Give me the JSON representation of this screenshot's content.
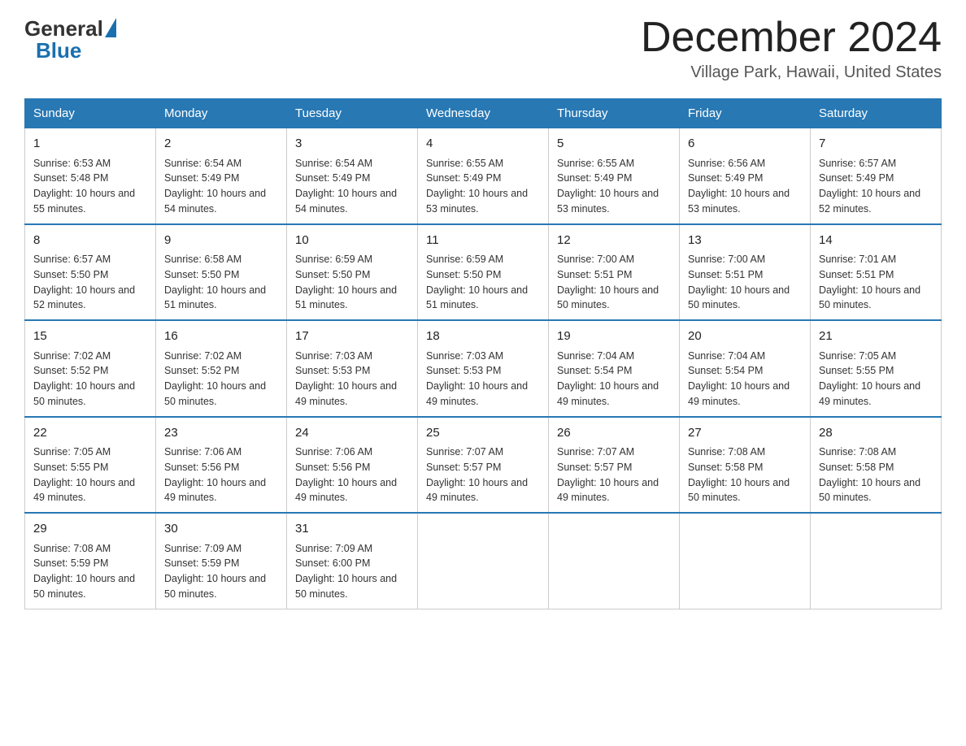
{
  "logo": {
    "general": "General",
    "blue": "Blue",
    "tagline": "Blue"
  },
  "header": {
    "month_year": "December 2024",
    "location": "Village Park, Hawaii, United States"
  },
  "weekdays": [
    "Sunday",
    "Monday",
    "Tuesday",
    "Wednesday",
    "Thursday",
    "Friday",
    "Saturday"
  ],
  "weeks": [
    [
      {
        "day": "1",
        "sunrise": "6:53 AM",
        "sunset": "5:48 PM",
        "daylight": "10 hours and 55 minutes."
      },
      {
        "day": "2",
        "sunrise": "6:54 AM",
        "sunset": "5:49 PM",
        "daylight": "10 hours and 54 minutes."
      },
      {
        "day": "3",
        "sunrise": "6:54 AM",
        "sunset": "5:49 PM",
        "daylight": "10 hours and 54 minutes."
      },
      {
        "day": "4",
        "sunrise": "6:55 AM",
        "sunset": "5:49 PM",
        "daylight": "10 hours and 53 minutes."
      },
      {
        "day": "5",
        "sunrise": "6:55 AM",
        "sunset": "5:49 PM",
        "daylight": "10 hours and 53 minutes."
      },
      {
        "day": "6",
        "sunrise": "6:56 AM",
        "sunset": "5:49 PM",
        "daylight": "10 hours and 53 minutes."
      },
      {
        "day": "7",
        "sunrise": "6:57 AM",
        "sunset": "5:49 PM",
        "daylight": "10 hours and 52 minutes."
      }
    ],
    [
      {
        "day": "8",
        "sunrise": "6:57 AM",
        "sunset": "5:50 PM",
        "daylight": "10 hours and 52 minutes."
      },
      {
        "day": "9",
        "sunrise": "6:58 AM",
        "sunset": "5:50 PM",
        "daylight": "10 hours and 51 minutes."
      },
      {
        "day": "10",
        "sunrise": "6:59 AM",
        "sunset": "5:50 PM",
        "daylight": "10 hours and 51 minutes."
      },
      {
        "day": "11",
        "sunrise": "6:59 AM",
        "sunset": "5:50 PM",
        "daylight": "10 hours and 51 minutes."
      },
      {
        "day": "12",
        "sunrise": "7:00 AM",
        "sunset": "5:51 PM",
        "daylight": "10 hours and 50 minutes."
      },
      {
        "day": "13",
        "sunrise": "7:00 AM",
        "sunset": "5:51 PM",
        "daylight": "10 hours and 50 minutes."
      },
      {
        "day": "14",
        "sunrise": "7:01 AM",
        "sunset": "5:51 PM",
        "daylight": "10 hours and 50 minutes."
      }
    ],
    [
      {
        "day": "15",
        "sunrise": "7:02 AM",
        "sunset": "5:52 PM",
        "daylight": "10 hours and 50 minutes."
      },
      {
        "day": "16",
        "sunrise": "7:02 AM",
        "sunset": "5:52 PM",
        "daylight": "10 hours and 50 minutes."
      },
      {
        "day": "17",
        "sunrise": "7:03 AM",
        "sunset": "5:53 PM",
        "daylight": "10 hours and 49 minutes."
      },
      {
        "day": "18",
        "sunrise": "7:03 AM",
        "sunset": "5:53 PM",
        "daylight": "10 hours and 49 minutes."
      },
      {
        "day": "19",
        "sunrise": "7:04 AM",
        "sunset": "5:54 PM",
        "daylight": "10 hours and 49 minutes."
      },
      {
        "day": "20",
        "sunrise": "7:04 AM",
        "sunset": "5:54 PM",
        "daylight": "10 hours and 49 minutes."
      },
      {
        "day": "21",
        "sunrise": "7:05 AM",
        "sunset": "5:55 PM",
        "daylight": "10 hours and 49 minutes."
      }
    ],
    [
      {
        "day": "22",
        "sunrise": "7:05 AM",
        "sunset": "5:55 PM",
        "daylight": "10 hours and 49 minutes."
      },
      {
        "day": "23",
        "sunrise": "7:06 AM",
        "sunset": "5:56 PM",
        "daylight": "10 hours and 49 minutes."
      },
      {
        "day": "24",
        "sunrise": "7:06 AM",
        "sunset": "5:56 PM",
        "daylight": "10 hours and 49 minutes."
      },
      {
        "day": "25",
        "sunrise": "7:07 AM",
        "sunset": "5:57 PM",
        "daylight": "10 hours and 49 minutes."
      },
      {
        "day": "26",
        "sunrise": "7:07 AM",
        "sunset": "5:57 PM",
        "daylight": "10 hours and 49 minutes."
      },
      {
        "day": "27",
        "sunrise": "7:08 AM",
        "sunset": "5:58 PM",
        "daylight": "10 hours and 50 minutes."
      },
      {
        "day": "28",
        "sunrise": "7:08 AM",
        "sunset": "5:58 PM",
        "daylight": "10 hours and 50 minutes."
      }
    ],
    [
      {
        "day": "29",
        "sunrise": "7:08 AM",
        "sunset": "5:59 PM",
        "daylight": "10 hours and 50 minutes."
      },
      {
        "day": "30",
        "sunrise": "7:09 AM",
        "sunset": "5:59 PM",
        "daylight": "10 hours and 50 minutes."
      },
      {
        "day": "31",
        "sunrise": "7:09 AM",
        "sunset": "6:00 PM",
        "daylight": "10 hours and 50 minutes."
      },
      null,
      null,
      null,
      null
    ]
  ]
}
